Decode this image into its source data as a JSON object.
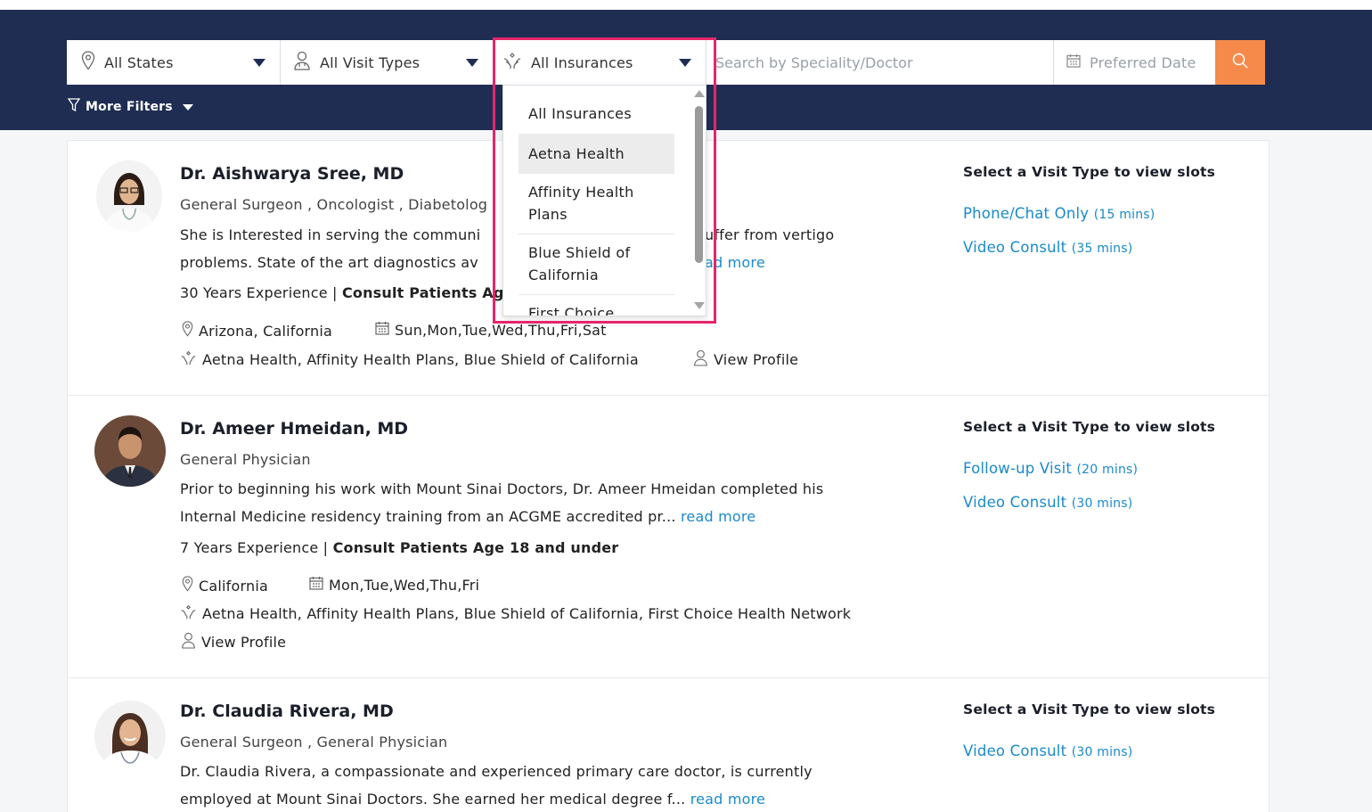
{
  "filters": {
    "states": "All States",
    "visit_types": "All Visit Types",
    "insurances": "All Insurances",
    "search_placeholder": "Search by Speciality/Doctor",
    "date_placeholder": "Preferred Date",
    "more_filters": "More Filters"
  },
  "insurance_dropdown": {
    "options": [
      "All Insurances",
      "Aetna Health",
      "Affinity Health Plans",
      "Blue Shield of California",
      "First Choice"
    ],
    "highlighted": "Aetna Health"
  },
  "slots_heading": "Select a Visit Type to view slots",
  "doctors": [
    {
      "name": "Dr. Aishwarya Sree, MD",
      "specialty": "General Surgeon , Oncologist , Diabetolog",
      "bio_line1": "She is Interested in serving the communi",
      "bio_line1_tail": "uffer from vertigo",
      "bio_line2": "problems. State of the art diagnostics av",
      "read_more": "ad more",
      "experience": "30 Years Experience |",
      "age": "Consult Patients Ag",
      "location": "Arizona, California",
      "days": "Sun,Mon,Tue,Wed,Thu,Fri,Sat",
      "insurances": "Aetna Health, Affinity Health Plans, Blue Shield of California",
      "view_profile": "View Profile",
      "slots": [
        {
          "label": "Phone/Chat Only",
          "duration": "(15 mins)"
        },
        {
          "label": "Video Consult",
          "duration": "(35 mins)"
        }
      ]
    },
    {
      "name": "Dr. Ameer Hmeidan, MD",
      "specialty": "General Physician",
      "bio_line1": "Prior to beginning his work with Mount Sinai Doctors, Dr. Ameer Hmeidan completed his",
      "bio_line2": "Internal Medicine residency training from an ACGME accredited pr...",
      "read_more": "read more",
      "experience": "7 Years Experience |",
      "age": "Consult Patients Age 18 and under",
      "location": "California",
      "days": "Mon,Tue,Wed,Thu,Fri",
      "insurances": "Aetna Health, Affinity Health Plans, Blue Shield of California, First Choice Health Network",
      "view_profile": "View Profile",
      "slots": [
        {
          "label": "Follow-up Visit",
          "duration": "(20 mins)"
        },
        {
          "label": "Video Consult",
          "duration": "(30 mins)"
        }
      ]
    },
    {
      "name": "Dr. Claudia Rivera, MD",
      "specialty": "General Surgeon , General Physician",
      "bio_line1": "Dr. Claudia Rivera, a compassionate and experienced primary care doctor, is currently",
      "bio_line2": "employed at Mount Sinai Doctors. She earned her medical degree f...",
      "read_more": "read more",
      "slots": [
        {
          "label": "Video Consult",
          "duration": "(30 mins)"
        }
      ]
    }
  ],
  "colors": {
    "header": "#1f2d52",
    "accent_orange": "#f58a4a",
    "link_blue": "#1a8ac9",
    "highlight_pink": "#e5266b"
  }
}
